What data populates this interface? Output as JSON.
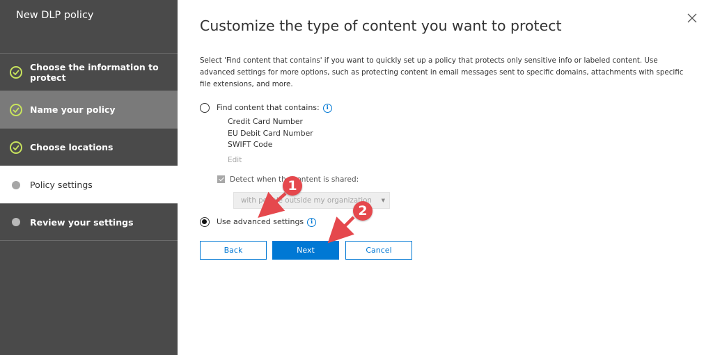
{
  "sidebar": {
    "title": "New DLP policy",
    "steps": [
      {
        "label": "Choose the information to protect",
        "state": "done"
      },
      {
        "label": "Name your policy",
        "state": "done"
      },
      {
        "label": "Choose locations",
        "state": "done"
      },
      {
        "label": "Policy settings",
        "state": "current"
      },
      {
        "label": "Review your settings",
        "state": "pending"
      }
    ]
  },
  "main": {
    "title": "Customize the type of content you want to protect",
    "description": "Select 'Find content that contains' if you want to quickly set up a policy that protects only sensitive info or labeled content. Use advanced settings for more options, such as protecting content in email messages sent to specific domains, attachments with specific file extensions, and more.",
    "option_find": {
      "label": "Find content that contains:",
      "selected": false
    },
    "content_types": [
      "Credit Card Number",
      "EU Debit Card Number",
      "SWIFT Code"
    ],
    "edit_label": "Edit",
    "detect": {
      "label": "Detect when the content is shared:",
      "checked": true
    },
    "share_select": {
      "value": "with people outside my organization"
    },
    "option_advanced": {
      "label": "Use advanced settings",
      "selected": true
    },
    "buttons": {
      "back": "Back",
      "next": "Next",
      "cancel": "Cancel"
    }
  },
  "annotations": {
    "badge_1": "1",
    "badge_2": "2"
  },
  "colors": {
    "sidebar_bg": "#4a4a4a",
    "accent": "#0078d4",
    "check": "#c8e35d",
    "annotation": "#e5484d"
  },
  "icons": {
    "close": "close-icon",
    "info": "info-icon",
    "check": "check-circle-icon",
    "dropdown": "caret-down-icon"
  }
}
